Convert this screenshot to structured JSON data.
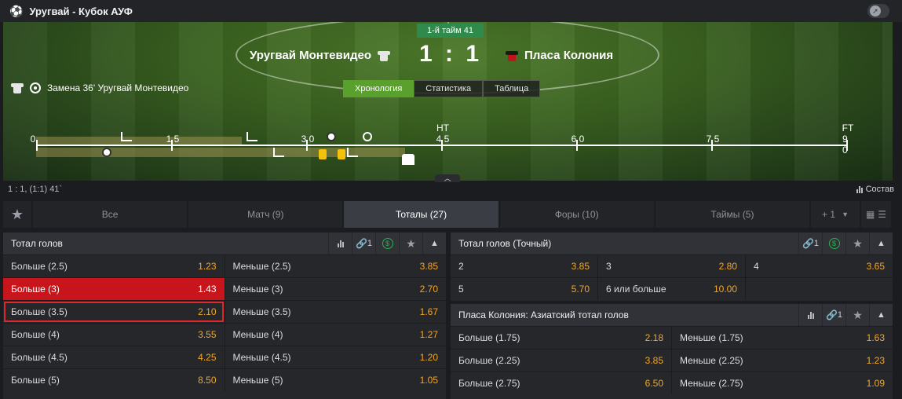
{
  "match": {
    "title": "Уругвай - Кубок АУФ",
    "timer": "1-й тайм 41",
    "home": "Уругвай Монтевидео",
    "away": "Пласа Колония",
    "score_home": "1",
    "score_away": "1",
    "score_sep": ":",
    "last_event": "Замена 36' Уругвай Монтевидео"
  },
  "view_tabs": [
    "Хронология",
    "Статистика",
    "Таблица"
  ],
  "timeline": {
    "labels": [
      "0",
      "1 5",
      "3 0",
      "4 5",
      "6 0",
      "7 5",
      "9 0"
    ],
    "ht": "HT",
    "ft": "FT"
  },
  "status": {
    "score_line": "1 : 1, (1:1) 41`",
    "lineup": "Состав"
  },
  "market_tabs": [
    "Все",
    "Матч (9)",
    "Тоталы (27)",
    "Форы (10)",
    "Таймы (5)",
    "+ 1"
  ],
  "markets": {
    "total_goals": {
      "title": "Тотал голов",
      "link_count": "1",
      "rows": [
        [
          {
            "label": "Больше (2.5)",
            "odd": "1.23"
          },
          {
            "label": "Меньше (2.5)",
            "odd": "3.85"
          }
        ],
        [
          {
            "label": "Больше (3)",
            "odd": "1.43"
          },
          {
            "label": "Меньше (3)",
            "odd": "2.70"
          }
        ],
        [
          {
            "label": "Больше (3.5)",
            "odd": "2.10"
          },
          {
            "label": "Меньше (3.5)",
            "odd": "1.67"
          }
        ],
        [
          {
            "label": "Больше (4)",
            "odd": "3.55"
          },
          {
            "label": "Меньше (4)",
            "odd": "1.27"
          }
        ],
        [
          {
            "label": "Больше (4.5)",
            "odd": "4.25"
          },
          {
            "label": "Меньше (4.5)",
            "odd": "1.20"
          }
        ],
        [
          {
            "label": "Больше (5)",
            "odd": "8.50"
          },
          {
            "label": "Меньше (5)",
            "odd": "1.05"
          }
        ]
      ]
    },
    "exact_total": {
      "title": "Тотал голов (Точный)",
      "link_count": "1",
      "rows": [
        [
          {
            "label": "2",
            "odd": "3.85"
          },
          {
            "label": "3",
            "odd": "2.80"
          },
          {
            "label": "4",
            "odd": "3.65"
          }
        ],
        [
          {
            "label": "5",
            "odd": "5.70"
          },
          {
            "label": "6 или больше",
            "odd": "10.00"
          }
        ]
      ]
    },
    "asian_total": {
      "title": "Пласа Колония: Азиатский тотал голов",
      "link_count": "1",
      "rows": [
        [
          {
            "label": "Больше (1.75)",
            "odd": "2.18"
          },
          {
            "label": "Меньше (1.75)",
            "odd": "1.63"
          }
        ],
        [
          {
            "label": "Больше (2.25)",
            "odd": "3.85"
          },
          {
            "label": "Меньше (2.25)",
            "odd": "1.23"
          }
        ],
        [
          {
            "label": "Больше (2.75)",
            "odd": "6.50"
          },
          {
            "label": "Меньше (2.75)",
            "odd": "1.09"
          }
        ]
      ]
    }
  }
}
